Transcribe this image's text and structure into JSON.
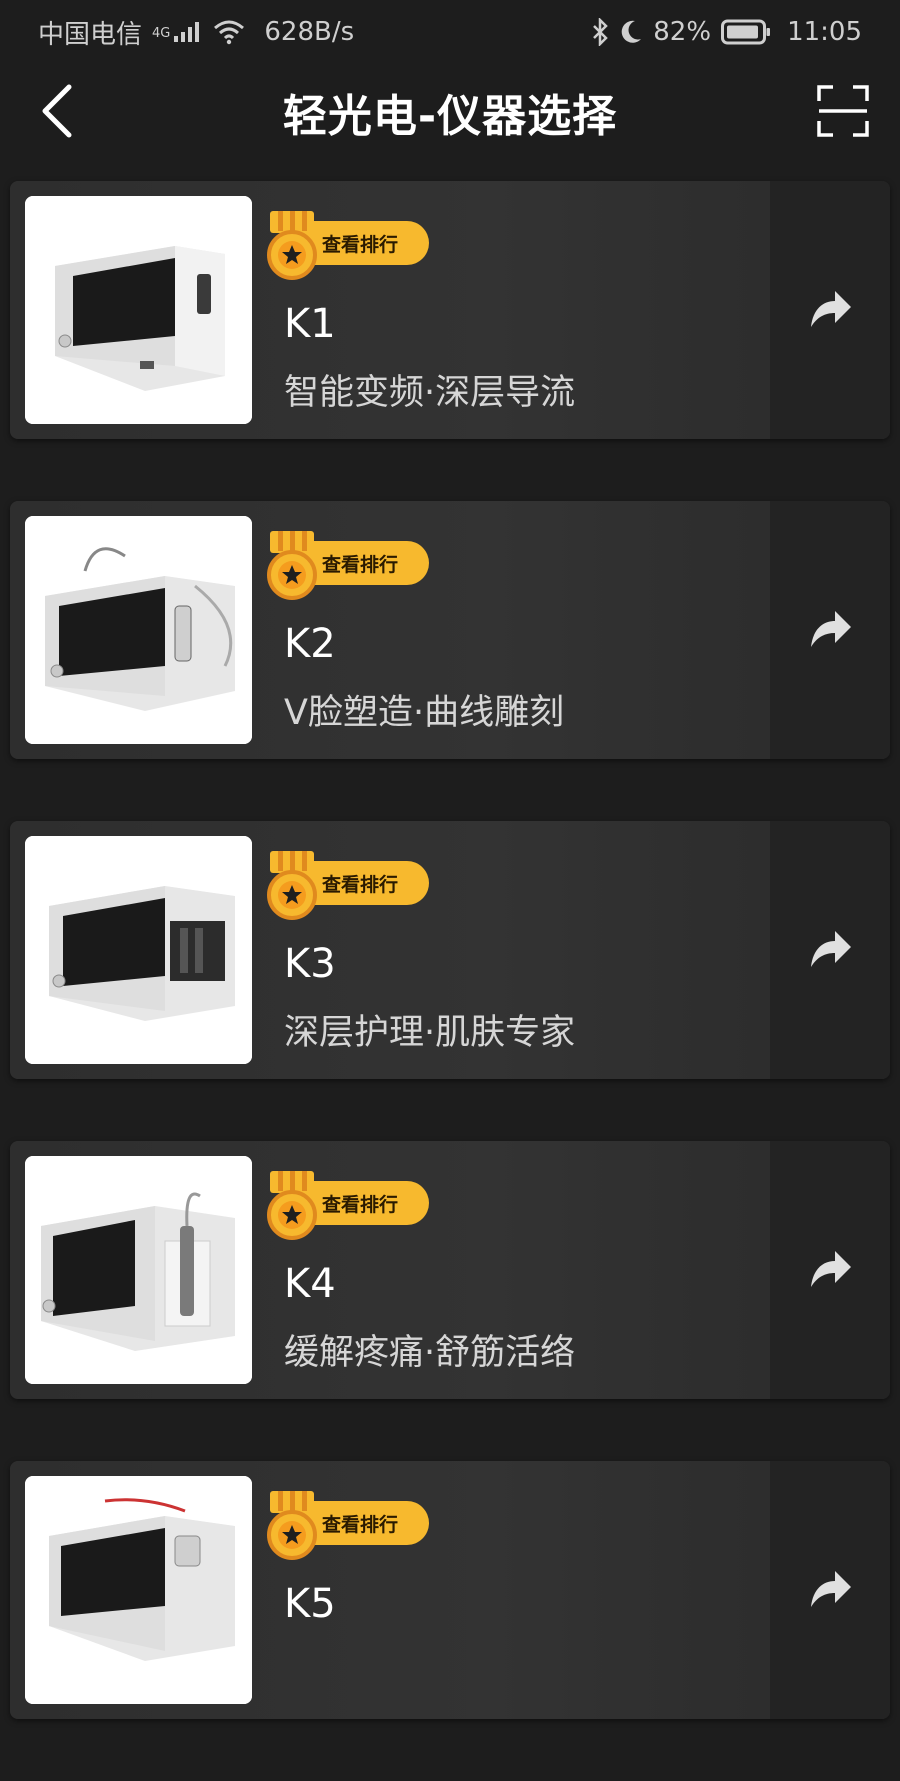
{
  "status_bar": {
    "carrier": "中国电信",
    "network": "4G",
    "speed": "628B/s",
    "battery": "82%",
    "time": "11:05"
  },
  "header": {
    "title": "轻光电-仪器选择",
    "back_icon": "chevron-left-icon",
    "scan_icon": "scan-icon"
  },
  "rank_label": "查看排行",
  "products": [
    {
      "name": "K1",
      "desc": "智能变频·深层导流"
    },
    {
      "name": "K2",
      "desc": "V脸塑造·曲线雕刻"
    },
    {
      "name": "K3",
      "desc": "深层护理·肌肤专家"
    },
    {
      "name": "K4",
      "desc": "缓解疼痛·舒筋活络"
    },
    {
      "name": "K5",
      "desc": ""
    }
  ],
  "colors": {
    "background": "#1d1d1d",
    "card": "#303030",
    "badge": "#f7b92e",
    "medal_ring": "#e08a1e"
  }
}
